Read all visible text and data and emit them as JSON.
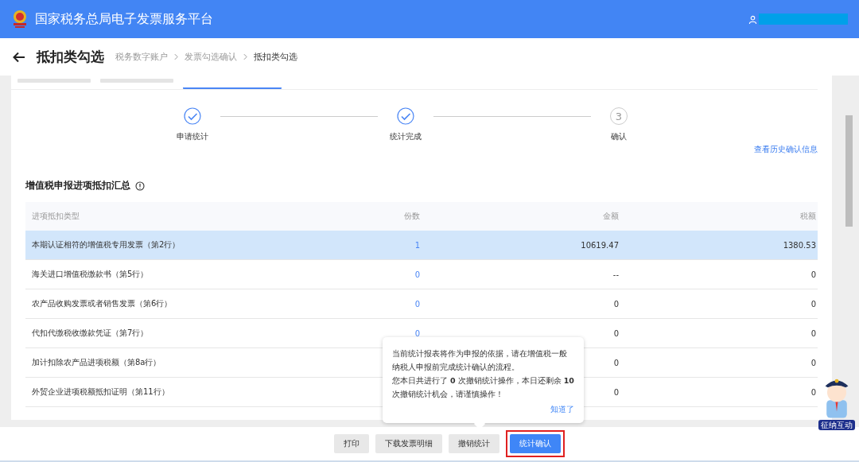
{
  "header": {
    "title": "国家税务总局电子发票服务平台"
  },
  "page": {
    "title": "抵扣类勾选",
    "breadcrumb": [
      "税务数字账户",
      "发票勾选确认",
      "抵扣类勾选"
    ]
  },
  "tabs": [
    {
      "selected": false
    },
    {
      "selected": false
    },
    {
      "selected": true
    }
  ],
  "steps": [
    {
      "label": "申请统计",
      "done": true
    },
    {
      "label": "统计完成",
      "done": true
    },
    {
      "label": "确认",
      "done": false,
      "number": "3"
    }
  ],
  "history_link": "查看历史确认信息",
  "section_title": "增值税申报进项抵扣汇总",
  "table": {
    "columns": [
      "进项抵扣类型",
      "份数",
      "金额",
      "税额"
    ],
    "rows": [
      {
        "type": "本期认证相符的增值税专用发票（第2行）",
        "count": "1",
        "amount": "10619.47",
        "tax": "1380.53",
        "selected": true
      },
      {
        "type": "海关进口增值税缴款书（第5行）",
        "count": "0",
        "amount": "--",
        "tax": "0",
        "selected": false
      },
      {
        "type": "农产品收购发票或者销售发票（第6行）",
        "count": "0",
        "amount": "0",
        "tax": "0",
        "selected": false
      },
      {
        "type": "代扣代缴税收缴款凭证（第7行）",
        "count": "0",
        "amount": "0",
        "tax": "0",
        "selected": false
      },
      {
        "type": "加计扣除农产品进项税额（第8a行）",
        "amount": "0",
        "tax": "0",
        "selected": false
      },
      {
        "type": "外贸企业进项税额抵扣证明（第11行）",
        "amount": "0",
        "tax": "0",
        "selected": false
      }
    ]
  },
  "tooltip": {
    "text": "当前统计报表将作为申报的依据，请在增值税一般纳税人申报前完成统计确认的流程。",
    "line2": "您本日共进行了 **0** 次撤销统计操作，本日还剩余 **10** 次撤销统计机会，请谨慎操作！",
    "button": "知道了"
  },
  "buttons": [
    {
      "label": "打印",
      "kind": "plain"
    },
    {
      "label": "下载发票明细",
      "kind": "plain"
    },
    {
      "label": "撤销统计",
      "kind": "plain"
    },
    {
      "label": "统计确认",
      "kind": "primary"
    }
  ],
  "mascot": {
    "badge": "征纳互动"
  }
}
